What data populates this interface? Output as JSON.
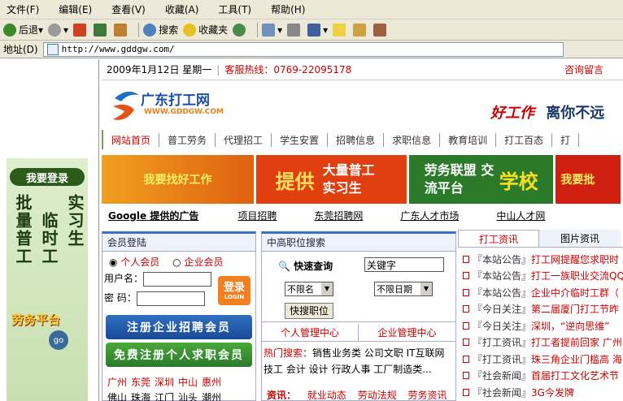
{
  "menu": [
    "文件(F)",
    "编辑(E)",
    "查看(V)",
    "收藏(A)",
    "工具(T)",
    "帮助(H)"
  ],
  "toolbar": {
    "back": "后退",
    "search": "搜索",
    "favorites": "收藏夹"
  },
  "address": {
    "label": "地址(D)",
    "url": "http://www.gddgw.com/"
  },
  "site": {
    "date": "2009年1月12日  星期一",
    "hotline": "客服热线：0769-22095178",
    "consult": "咨询留言",
    "logo_cn": "广东打工网",
    "logo_en": "WWW.GDDGW.COM",
    "slogan_brand": "好工作",
    "slogan": "离你不远",
    "nav": [
      "网站首页",
      "普工劳务",
      "代理招工",
      "学生安置",
      "招聘信息",
      "求职信息",
      "教育培训",
      "打工百态",
      "打"
    ],
    "banners": [
      "我要找好工作",
      "提供",
      "大量普工 实习生",
      "劳务联盟 交流平台",
      "学校",
      "我要批"
    ],
    "links_title": "Google 提供的广告",
    "links": [
      "项目招聘",
      "东莞招聘网",
      "广东人才市场",
      "中山人才网"
    ]
  },
  "leftad": {
    "btn": "我要登录",
    "col1": "批量普工",
    "col2": "临时工",
    "col3": "实习生",
    "bottom": "劳务平台",
    "go": "go"
  },
  "login": {
    "title": "会员登陆",
    "radio1": "个人会员",
    "radio2": "企业会员",
    "user": "用户名：",
    "pass": "密  码：",
    "btn": "登录",
    "btn_sub": "LOGIN",
    "reg1": "注册企业招聘会员",
    "reg2": "免费注册个人求职会员",
    "cities1": [
      "广州",
      "东莞",
      "深圳",
      "中山",
      "惠州"
    ],
    "cities2": [
      "佛山",
      "珠海",
      "江门",
      "汕头",
      "潮州"
    ]
  },
  "search": {
    "title": "中高职位搜索",
    "quick": "快速查询",
    "keyword": "关键字",
    "sel1": "不限名",
    "sel2": "不限日期",
    "btn": "快搜职位",
    "center1": "个人管理中心",
    "center2": "企业管理中心",
    "hot_label": "热门搜索：",
    "hot": "销售业务类  公司文职  IT互联网  技工  会计  设计  行政人事  工厂制造类...",
    "info_label": "资讯：",
    "info": [
      "就业动态",
      "劳动法规",
      "劳务资讯"
    ]
  },
  "news": {
    "tabs": [
      "打工资讯",
      "图片资讯"
    ],
    "items": [
      {
        "tag": "『本站公告』",
        "text": "打工网提醒您求职时"
      },
      {
        "tag": "『本站公告』",
        "text": "打工一族职业交流QQ"
      },
      {
        "tag": "『本站公告』",
        "text": "企业中介临时工群（"
      },
      {
        "tag": "『今日关注』",
        "text": "第二届厦门打工节昨"
      },
      {
        "tag": "『今日关注』",
        "text": "深圳，“逆向思维”"
      },
      {
        "tag": "『打工资讯』",
        "text": "打工者提前回家 广州"
      },
      {
        "tag": "『打工资讯』",
        "text": "珠三角企业门槛高 海"
      },
      {
        "tag": "『社会新闻』",
        "text": "首届打工文化艺术节"
      },
      {
        "tag": "『社会新闻』",
        "text": "3G今发牌"
      }
    ]
  }
}
